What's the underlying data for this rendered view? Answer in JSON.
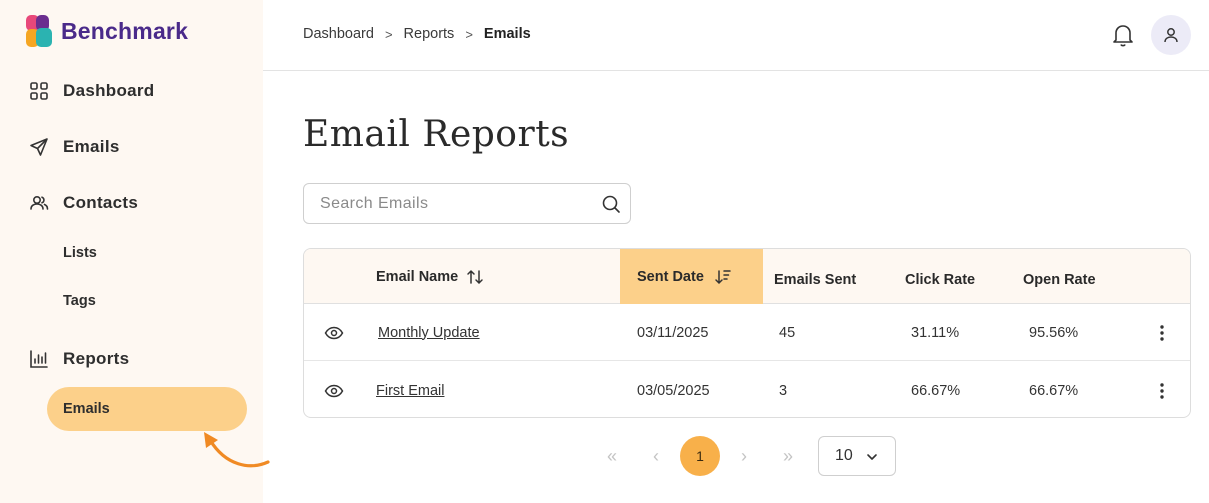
{
  "brand": {
    "name": "Benchmark"
  },
  "sidebar": {
    "items": [
      {
        "label": "Dashboard",
        "icon": "grid-icon"
      },
      {
        "label": "Emails",
        "icon": "send-icon"
      },
      {
        "label": "Contacts",
        "icon": "users-icon"
      },
      {
        "label": "Lists"
      },
      {
        "label": "Tags"
      },
      {
        "label": "Reports",
        "icon": "bar-chart-icon"
      },
      {
        "label": "Emails",
        "active": true
      }
    ]
  },
  "header": {
    "breadcrumb": [
      "Dashboard",
      "Reports",
      "Emails"
    ],
    "separator": ">"
  },
  "main": {
    "title": "Email Reports",
    "search": {
      "placeholder": "Search Emails",
      "value": ""
    },
    "table": {
      "columns": [
        "Email Name",
        "Sent Date",
        "Emails Sent",
        "Click Rate",
        "Open Rate"
      ],
      "sorted_column": "Sent Date",
      "rows": [
        {
          "name": "Monthly Update",
          "sent_date": "03/11/2025",
          "emails_sent": "45",
          "click_rate": "31.11%",
          "open_rate": "95.56%"
        },
        {
          "name": "First Email",
          "sent_date": "03/05/2025",
          "emails_sent": "3",
          "click_rate": "66.67%",
          "open_rate": "66.67%"
        }
      ]
    },
    "pagination": {
      "first": "«",
      "prev": "‹",
      "current_page": "1",
      "next": "›",
      "last": "»",
      "page_size": "10"
    }
  },
  "colors": {
    "sidebar_bg": "#fef8f2",
    "accent": "#fcd08a",
    "active_page": "#f8b04a",
    "arrow": "#f08a24",
    "brand_text": "#4a2a8a"
  }
}
